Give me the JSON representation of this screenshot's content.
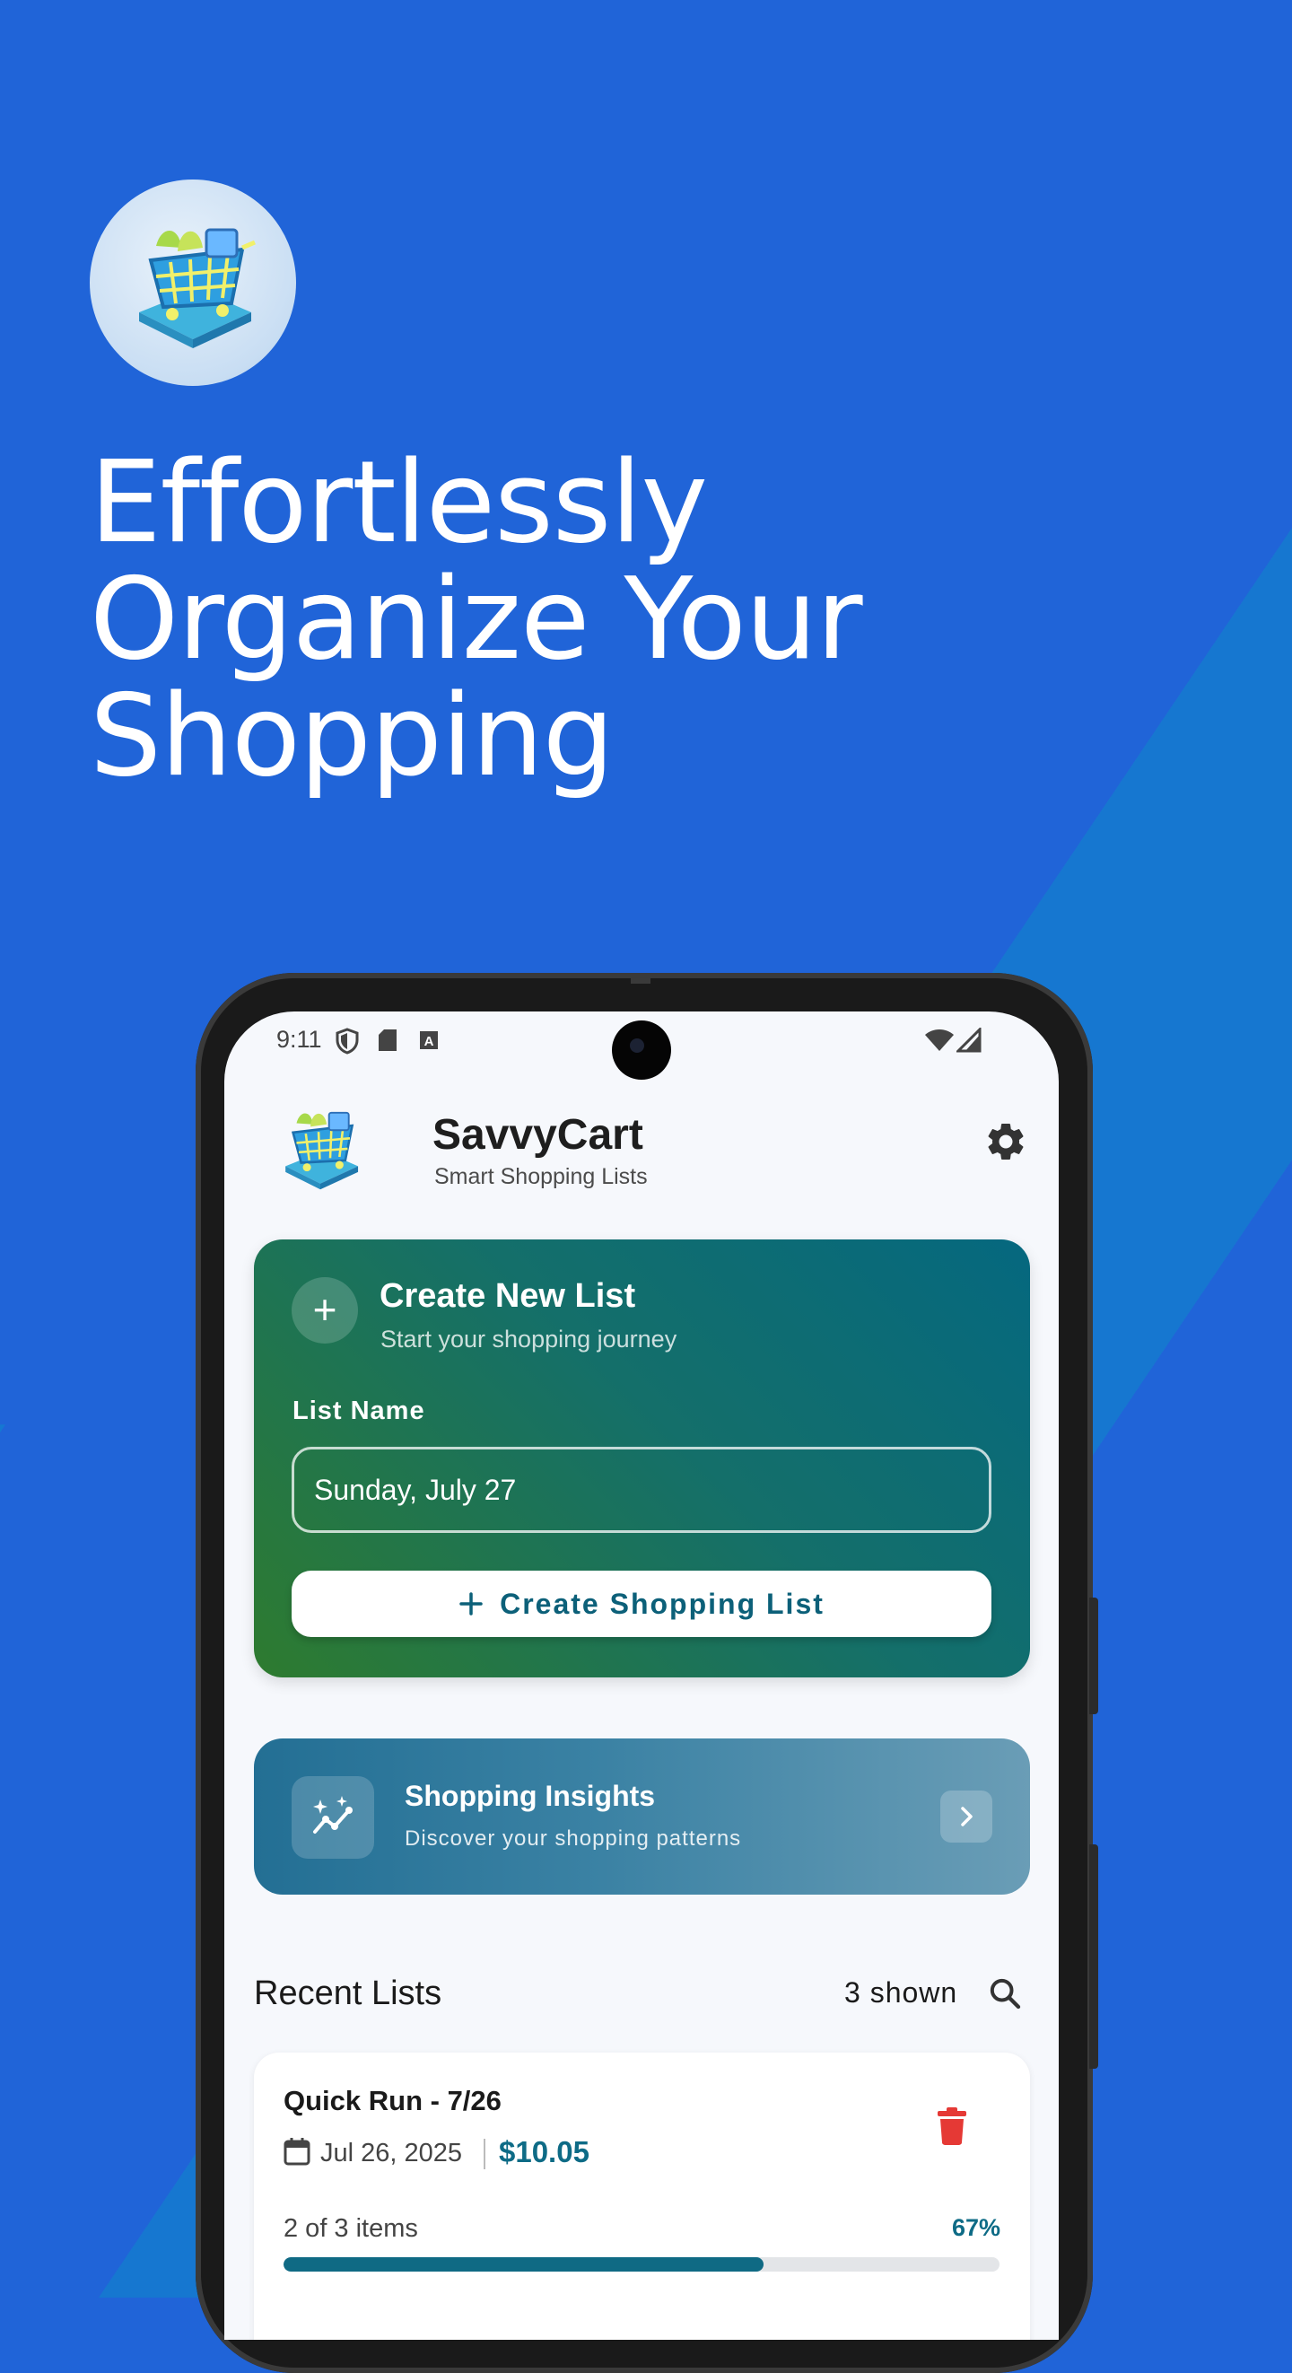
{
  "marketing": {
    "headline": "Effortlessly\nOrganize Your\nShopping",
    "logo_icon": "shopping-cart-icon"
  },
  "status_bar": {
    "time": "9:11",
    "icons": [
      "shield-icon",
      "sd-card-icon",
      "a-box-icon",
      "wifi-icon",
      "signal-icon"
    ]
  },
  "app": {
    "name": "SavvyCart",
    "tagline": "Smart Shopping Lists",
    "settings_icon": "gear-icon"
  },
  "create_card": {
    "title": "Create New List",
    "subtitle": "Start your shopping journey",
    "field_label": "List Name",
    "field_value": "Sunday, July 27",
    "button_label": "Create Shopping List",
    "button_icon": "plus-icon"
  },
  "insights_card": {
    "title": "Shopping Insights",
    "subtitle": "Discover your shopping patterns",
    "icon": "sparkle-trend-icon",
    "chevron_icon": "chevron-right-icon"
  },
  "recent": {
    "title": "Recent Lists",
    "count": "3 shown",
    "search_icon": "search-icon",
    "lists": [
      {
        "title": "Quick Run - 7/26",
        "date": "Jul 26, 2025",
        "price": "$10.05",
        "items": "2 of 3 items",
        "percent": "67%",
        "progress": 0.67
      }
    ]
  },
  "colors": {
    "background": "#2064d8",
    "accent": "#0e6b86",
    "delete": "#e53935",
    "create_card_start": "#2e7b2f",
    "create_card_end": "#05687f"
  }
}
